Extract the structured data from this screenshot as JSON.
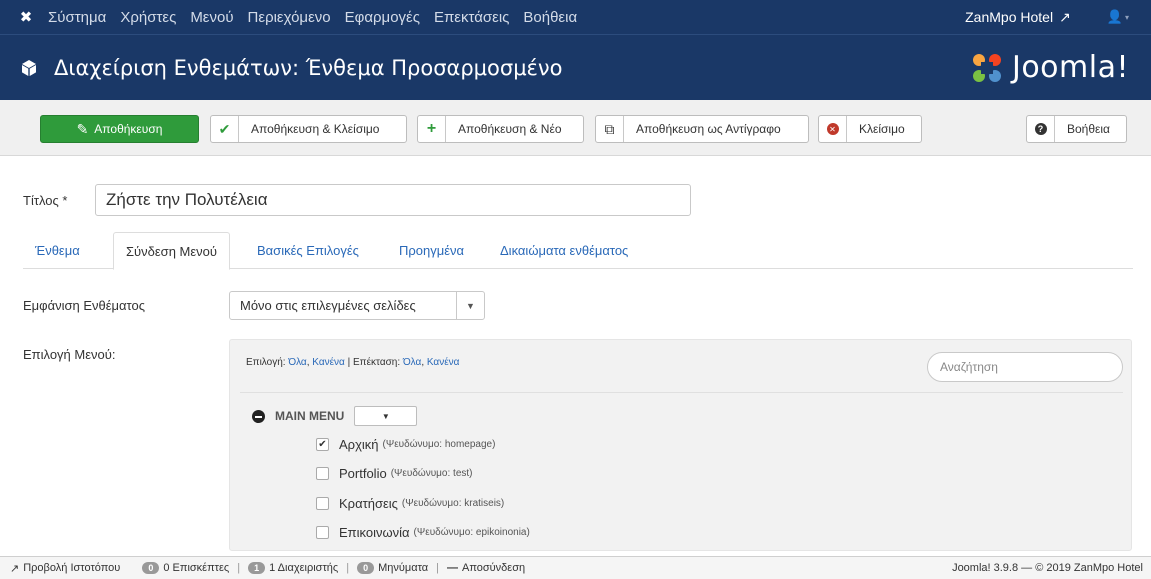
{
  "topnav": {
    "menu": [
      "Σύστημα",
      "Χρήστες",
      "Μενού",
      "Περιεχόμενο",
      "Εφαρμογές",
      "Επεκτάσεις",
      "Βοήθεια"
    ],
    "site_name": "ZanMpo Hotel"
  },
  "header": {
    "title": "Διαχείριση Ενθεμάτων: Ένθεμα Προσαρμοσμένο",
    "brand": "Joomla!"
  },
  "toolbar": {
    "save": "Αποθήκευση",
    "save_close": "Αποθήκευση & Κλείσιμο",
    "save_new": "Αποθήκευση & Νέο",
    "save_copy": "Αποθήκευση ως Αντίγραφο",
    "close": "Κλείσιμο",
    "help": "Βοήθεια"
  },
  "form": {
    "title_label": "Τίτλος *",
    "title_value": "Ζήστε την Πολυτέλεια",
    "tabs": [
      "Ένθεμα",
      "Σύνδεση Μενού",
      "Βασικές Επιλογές",
      "Προηγμένα",
      "Δικαιώματα ενθέματος"
    ],
    "active_tab": "Σύνδεση Μενού",
    "display_label": "Εμφάνιση Ενθέματος",
    "display_value": "Μόνο στις επιλεγμένες σελίδες",
    "menu_select_label": "Επιλογή Μενού:"
  },
  "menu_panel": {
    "select_prefix": "Επιλογή:",
    "all": "Όλα",
    "none": "Κανένα",
    "expand_prefix": "Επέκταση:",
    "search_placeholder": "Αναζήτηση",
    "menu_name": "MAIN MENU",
    "items": [
      {
        "label": "Αρχική",
        "alias": "(Ψευδώνυμο: homepage)",
        "checked": true
      },
      {
        "label": "Portfolio",
        "alias": "(Ψευδώνυμο: test)",
        "checked": false
      },
      {
        "label": "Κρατήσεις",
        "alias": "(Ψευδώνυμο: kratiseis)",
        "checked": false
      },
      {
        "label": "Επικοινωνία",
        "alias": "(Ψευδώνυμο: epikoinonia)",
        "checked": false
      }
    ]
  },
  "statusbar": {
    "view_site": "Προβολή Ιστοτόπου",
    "visitors_count": "0",
    "visitors": "0 Επισκέπτες",
    "admins_count": "1",
    "admins": "1 Διαχειριστής",
    "messages_count": "0",
    "messages": "Μηνύματα",
    "logout": "Αποσύνδεση",
    "version": "Joomla! 3.9.8 — © 2019 ZanMpo Hotel"
  },
  "colors": {
    "navbar": "#1a3867",
    "save_green": "#2f9b3b",
    "link_blue": "#2a69b8"
  }
}
